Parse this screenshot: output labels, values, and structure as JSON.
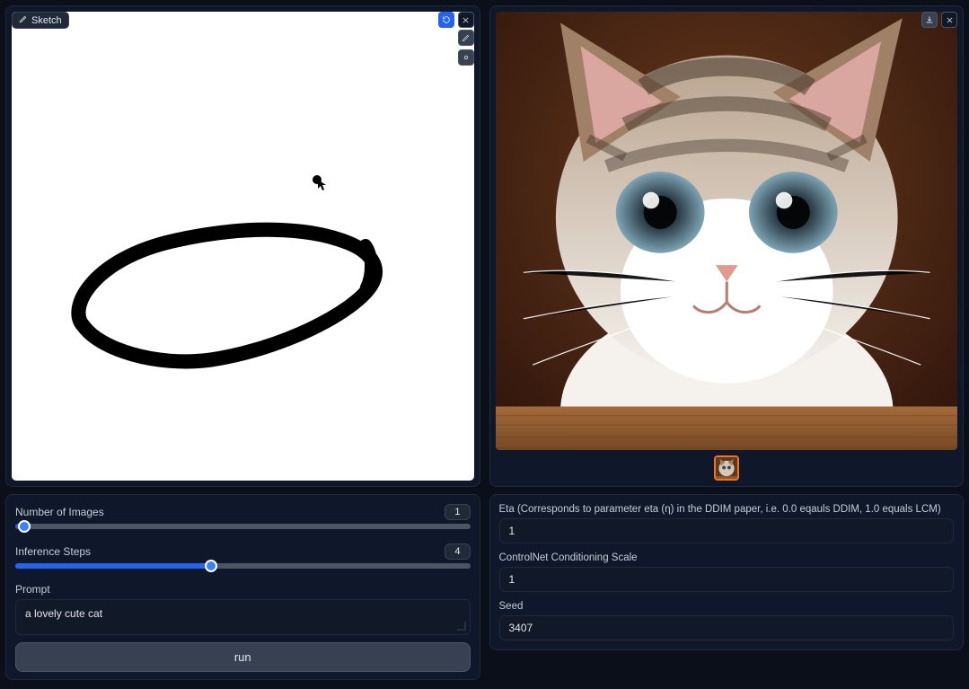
{
  "left": {
    "sketch_tab_label": "Sketch",
    "slider_num_images": {
      "label": "Number of Images",
      "value": "1",
      "fill_percent": 0
    },
    "slider_inference_steps": {
      "label": "Inference Steps",
      "value": "4",
      "fill_percent": 43
    },
    "prompt_label": "Prompt",
    "prompt_value": "a lovely cute cat",
    "run_label": "run"
  },
  "right": {
    "eta": {
      "label": "Eta (Corresponds to parameter eta (η) in the DDIM paper, i.e. 0.0 eqauls DDIM, 1.0 equals LCM)",
      "value": "1"
    },
    "controlnet": {
      "label": "ControlNet Conditioning Scale",
      "value": "1"
    },
    "seed": {
      "label": "Seed",
      "value": "3407"
    }
  },
  "icons": {
    "pencil": "pencil-icon",
    "edit": "edit-icon",
    "reset": "reset-icon",
    "close": "close-icon",
    "download": "download-icon"
  }
}
